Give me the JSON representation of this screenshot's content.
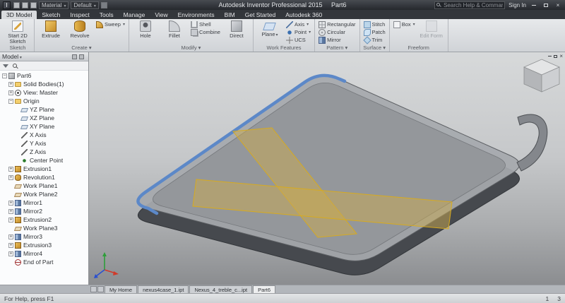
{
  "title_bar": {
    "app_title": "Autodesk Inventor Professional 2015",
    "document_title": "Part6",
    "material_dropdown": "Material",
    "appearance_dropdown": "Default",
    "search_placeholder": "Search Help & Commands...",
    "sign_in_label": "Sign In"
  },
  "ribbon": {
    "active_tab": "3D Model",
    "tabs": [
      "3D Model",
      "Sketch",
      "Inspect",
      "Tools",
      "Manage",
      "View",
      "Environments",
      "BIM",
      "Get Started",
      "Autodesk 360"
    ],
    "groups": {
      "sketch": {
        "label": "Sketch",
        "buttons": {
          "start2d": "Start 2D Sketch"
        }
      },
      "create": {
        "label": "Create ▾",
        "buttons": {
          "extrude": "Extrude",
          "revolve": "Revolve",
          "sweep": "Sweep"
        }
      },
      "modify": {
        "label": "Modify ▾",
        "buttons": {
          "hole": "Hole",
          "fillet": "Fillet",
          "shell": "Shell",
          "combine": "Combine",
          "direct": "Direct"
        }
      },
      "work_features": {
        "label": "Work Features",
        "buttons": {
          "plane": "Plane",
          "axis": "Axis",
          "point": "Point",
          "ucs": "UCS"
        }
      },
      "pattern": {
        "label": "Pattern ▾",
        "buttons": {
          "rectangular": "Rectangular",
          "circular": "Circular",
          "mirror": "Mirror"
        }
      },
      "surface": {
        "label": "Surface ▾",
        "buttons": {
          "stitch": "Stitch",
          "patch": "Patch",
          "trim": "Trim"
        }
      },
      "freeform": {
        "label": "Freeform",
        "buttons": {
          "box": "Box",
          "edit_form": "Edit Form"
        }
      }
    }
  },
  "browser": {
    "panel_title": "Model",
    "tree": [
      {
        "label": "Part6",
        "icon": "part",
        "indent": 0,
        "expander": "minus"
      },
      {
        "label": "Solid Bodies(1)",
        "icon": "folder",
        "indent": 1,
        "expander": "plus"
      },
      {
        "label": "View: Master",
        "icon": "eye",
        "indent": 1,
        "expander": "plus"
      },
      {
        "label": "Origin",
        "icon": "folder",
        "indent": 1,
        "expander": "minus"
      },
      {
        "label": "YZ Plane",
        "icon": "plane",
        "indent": 2,
        "expander": null
      },
      {
        "label": "XZ Plane",
        "icon": "plane",
        "indent": 2,
        "expander": null
      },
      {
        "label": "XY Plane",
        "icon": "plane",
        "indent": 2,
        "expander": null
      },
      {
        "label": "X Axis",
        "icon": "axis",
        "indent": 2,
        "expander": null
      },
      {
        "label": "Y Axis",
        "icon": "axis",
        "indent": 2,
        "expander": null
      },
      {
        "label": "Z Axis",
        "icon": "axis",
        "indent": 2,
        "expander": null
      },
      {
        "label": "Center Point",
        "icon": "point",
        "indent": 2,
        "expander": null
      },
      {
        "label": "Extrusion1",
        "icon": "extrusion",
        "indent": 1,
        "expander": "plus"
      },
      {
        "label": "Revolution1",
        "icon": "revolution",
        "indent": 1,
        "expander": "plus"
      },
      {
        "label": "Work Plane1",
        "icon": "workplane",
        "indent": 1,
        "expander": null
      },
      {
        "label": "Work Plane2",
        "icon": "workplane",
        "indent": 1,
        "expander": null
      },
      {
        "label": "Mirror1",
        "icon": "mirror",
        "indent": 1,
        "expander": "plus"
      },
      {
        "label": "Mirror2",
        "icon": "mirror",
        "indent": 1,
        "expander": "plus"
      },
      {
        "label": "Extrusion2",
        "icon": "extrusion",
        "indent": 1,
        "expander": "plus"
      },
      {
        "label": "Work Plane3",
        "icon": "workplane",
        "indent": 1,
        "expander": null
      },
      {
        "label": "Mirror3",
        "icon": "mirror",
        "indent": 1,
        "expander": "plus"
      },
      {
        "label": "Extrusion3",
        "icon": "extrusion",
        "indent": 1,
        "expander": "plus"
      },
      {
        "label": "Mirror4",
        "icon": "mirror",
        "indent": 1,
        "expander": "plus"
      },
      {
        "label": "End of Part",
        "icon": "eop",
        "indent": 1,
        "expander": null
      }
    ]
  },
  "viewport": {
    "selected_edge_color": "#5c88c8",
    "work_plane_fill": "#c9a94f",
    "work_plane_edge": "#d8ab1e",
    "case_body_color": "#46494e",
    "case_top_color": "#a6a9ad"
  },
  "document_tabs": {
    "tabs": [
      {
        "label": "My Home",
        "active": false
      },
      {
        "label": "nexus4case_1.ipt",
        "active": false
      },
      {
        "label": "Nexus_4_treble_c...ipt",
        "active": false
      },
      {
        "label": "Part6",
        "active": true
      }
    ]
  },
  "status_bar": {
    "message": "For Help, press F1",
    "right_values": [
      "1",
      "3"
    ]
  }
}
